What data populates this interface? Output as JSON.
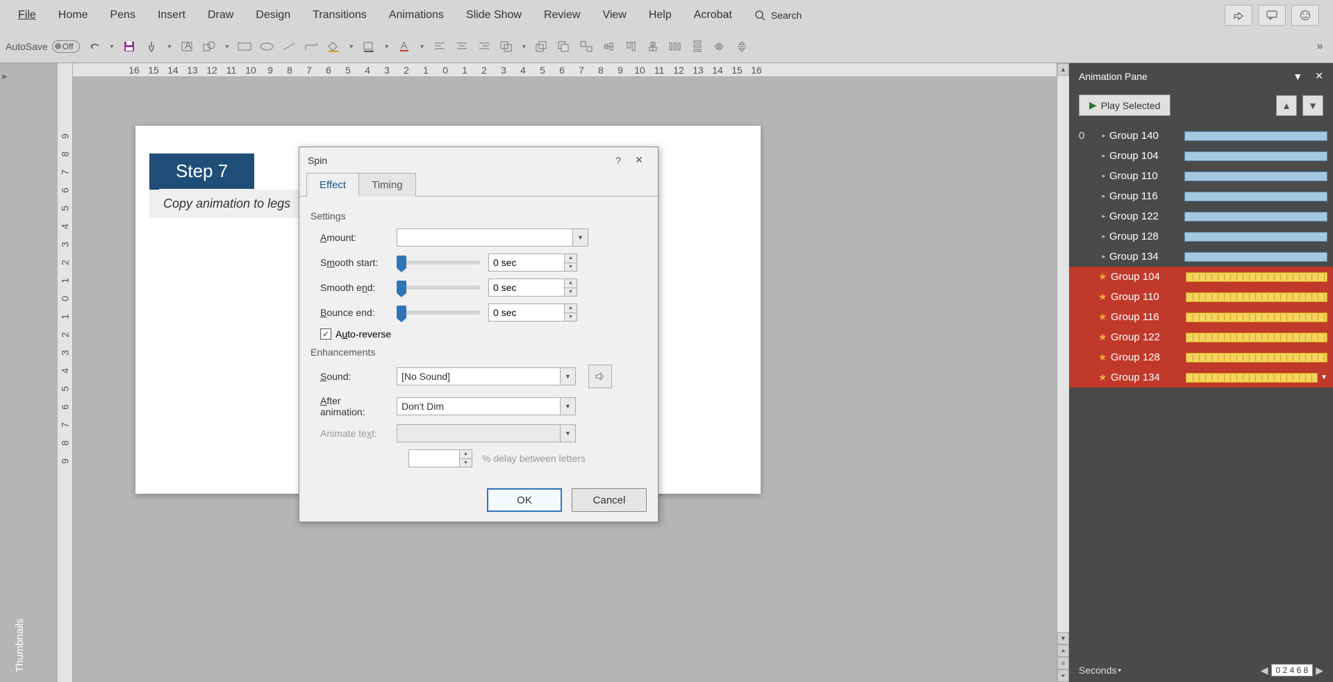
{
  "ribbon": {
    "tabs": [
      "File",
      "Home",
      "Pens",
      "Insert",
      "Draw",
      "Design",
      "Transitions",
      "Animations",
      "Slide Show",
      "Review",
      "View",
      "Help",
      "Acrobat"
    ],
    "search": "Search",
    "autosave_label": "AutoSave",
    "autosave_state": "Off"
  },
  "ruler_h": [
    "16",
    "15",
    "14",
    "13",
    "12",
    "11",
    "10",
    "9",
    "8",
    "7",
    "6",
    "5",
    "4",
    "3",
    "2",
    "1",
    "0",
    "1",
    "2",
    "3",
    "4",
    "5",
    "6",
    "7",
    "8",
    "9",
    "10",
    "11",
    "12",
    "13",
    "14",
    "15",
    "16"
  ],
  "ruler_v": [
    "9",
    "8",
    "7",
    "6",
    "5",
    "4",
    "3",
    "2",
    "1",
    "0",
    "1",
    "2",
    "3",
    "4",
    "5",
    "6",
    "7",
    "8",
    "9"
  ],
  "thumbnails_label": "Thumbnails",
  "slide": {
    "step_title": "Step 7",
    "step_subtitle": "Copy animation to legs"
  },
  "dialog": {
    "title": "Spin",
    "help": "?",
    "close": "✕",
    "tabs": {
      "effect": "Effect",
      "timing": "Timing"
    },
    "settings_label": "Settings",
    "amount_label": "Amount:",
    "amount_value": "",
    "smooth_start_label": "Smooth start:",
    "smooth_start_value": "0 sec",
    "smooth_end_label": "Smooth end:",
    "smooth_end_value": "0 sec",
    "bounce_end_label": "Bounce end:",
    "bounce_end_value": "0 sec",
    "auto_reverse_label": "Auto-reverse",
    "enhancements_label": "Enhancements",
    "sound_label": "Sound:",
    "sound_value": "[No Sound]",
    "after_label": "After animation:",
    "after_value": "Don't Dim",
    "animate_text_label": "Animate text:",
    "delay_label": "% delay between letters",
    "ok": "OK",
    "cancel": "Cancel"
  },
  "anim_pane": {
    "title": "Animation Pane",
    "play": "Play Selected",
    "index0": "0",
    "items_a": [
      {
        "label": "Group 140"
      },
      {
        "label": "Group 104"
      },
      {
        "label": "Group 110"
      },
      {
        "label": "Group 116"
      },
      {
        "label": "Group 122"
      },
      {
        "label": "Group 128"
      },
      {
        "label": "Group 134"
      }
    ],
    "items_b": [
      {
        "label": "Group 104"
      },
      {
        "label": "Group 110"
      },
      {
        "label": "Group 116"
      },
      {
        "label": "Group 122"
      },
      {
        "label": "Group 128"
      },
      {
        "label": "Group 134"
      }
    ],
    "seconds_label": "Seconds",
    "second_marks": "0   2   4   6   8"
  }
}
